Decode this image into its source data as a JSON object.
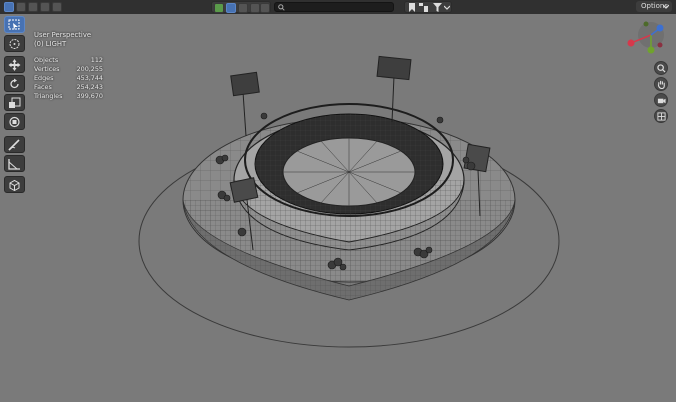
{
  "header": {
    "options_label": "Options",
    "search_placeholder": "",
    "mode_icons": [
      "object-mode-icon",
      "view-icon",
      "select-icon",
      "add-icon",
      "object-icon"
    ],
    "shading_icons": [
      "wireframe-shading-icon",
      "solid-shading-icon",
      "material-shading-icon",
      "rendered-shading-icon"
    ]
  },
  "viewport": {
    "view_name": "User Perspective",
    "collection_label": "(0) LIGHT",
    "stats": [
      {
        "label": "Objects",
        "value": "112"
      },
      {
        "label": "Vertices",
        "value": "200,255"
      },
      {
        "label": "Edges",
        "value": "453,744"
      },
      {
        "label": "Faces",
        "value": "254,243"
      },
      {
        "label": "Triangles",
        "value": "399,670"
      }
    ]
  },
  "toolbar": {
    "tools": [
      "select-box-icon",
      "cursor-icon",
      "move-icon",
      "rotate-icon",
      "scale-icon",
      "transform-icon",
      "annotate-icon",
      "measure-icon",
      "add-cube-icon"
    ]
  },
  "colors": {
    "accent": "#4772b3",
    "axis_x": "#d6384b",
    "axis_y": "#70a32d",
    "axis_z": "#3d70d1"
  }
}
